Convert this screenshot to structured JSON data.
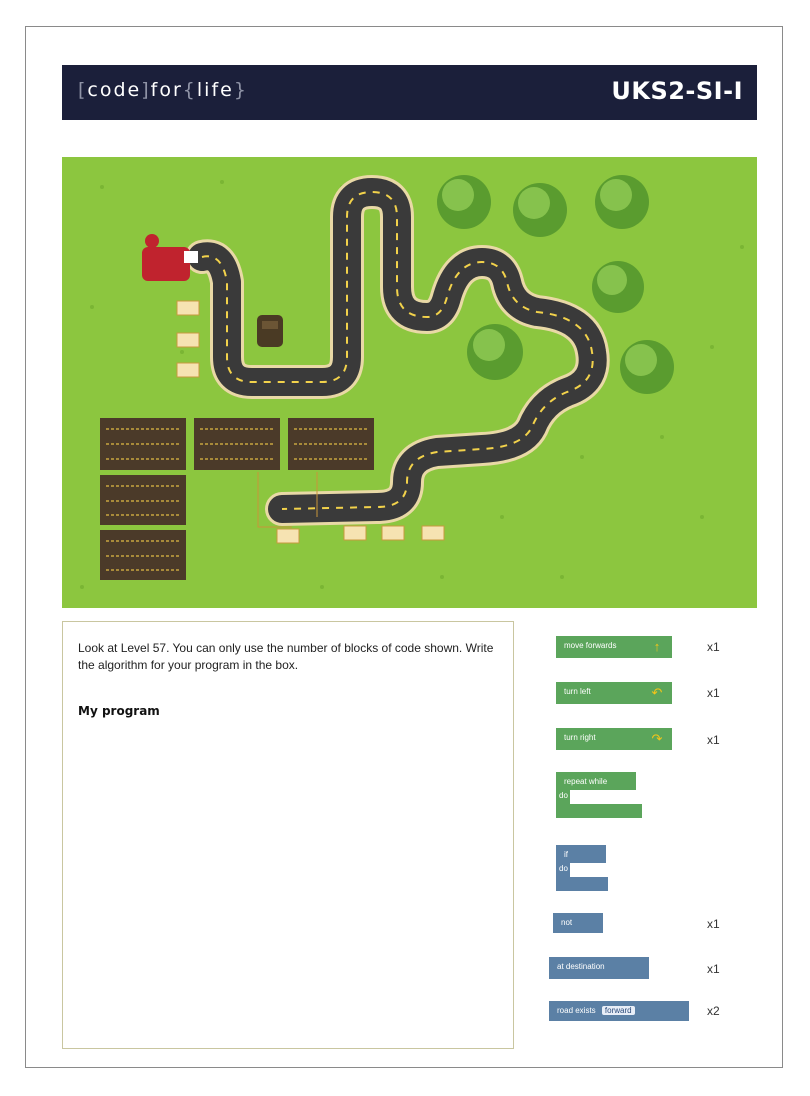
{
  "header": {
    "brand": "[code]for{life}",
    "code_id": "UKS2-SI-I"
  },
  "task": {
    "instruction": "Look at Level 57. You can only use the number of blocks of code shown. Write the algorithm for your program in the box.",
    "my_program_label": "My program"
  },
  "blocks": [
    {
      "label": "move forwards",
      "count": "x1",
      "color": "#5ba55b",
      "icon": "arrow-up-icon"
    },
    {
      "label": "turn left",
      "count": "x1",
      "color": "#5ba55b",
      "icon": "turn-left-icon"
    },
    {
      "label": "turn right",
      "count": "x1",
      "color": "#5ba55b",
      "icon": "turn-right-icon"
    },
    {
      "label": "repeat while",
      "sub": "do",
      "count": "",
      "color": "#5ba55b"
    },
    {
      "label": "if",
      "sub": "do",
      "count": "",
      "color": "#5b80a5"
    },
    {
      "label": "not",
      "count": "x1",
      "color": "#5b80a5"
    },
    {
      "label": "at destination",
      "count": "x1",
      "color": "#5b80a5"
    },
    {
      "label": "road exists",
      "field": "forward",
      "count": "x2",
      "color": "#5b80a5"
    }
  ],
  "colors": {
    "banner": "#1b1f3a",
    "grass": "#8cc63f",
    "road": "#3a3a3a",
    "block_green": "#5ba55b",
    "block_blue": "#5b80a5"
  }
}
